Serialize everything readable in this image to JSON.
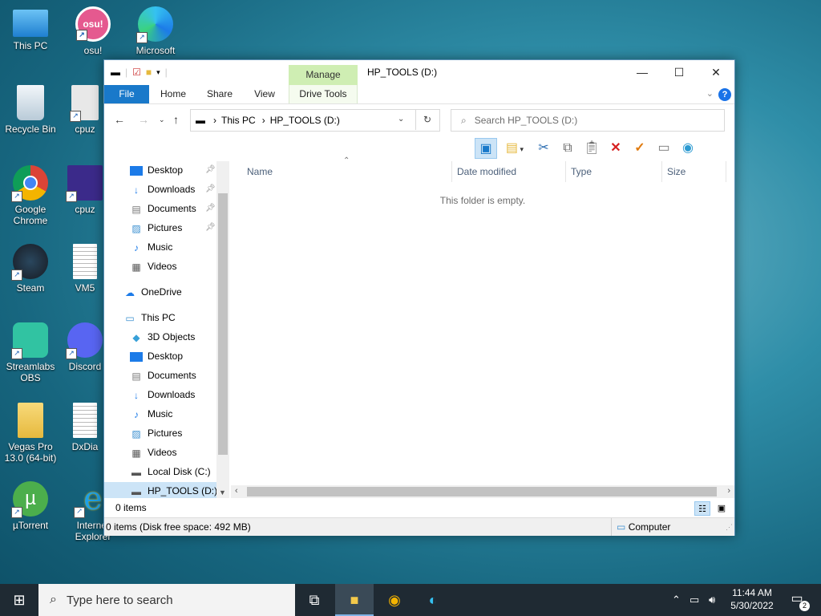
{
  "desktop": {
    "icons": [
      {
        "label": "This PC"
      },
      {
        "label": "osu!",
        "badge": "osu!"
      },
      {
        "label": "Microsoft"
      },
      {
        "label": "Recycle Bin"
      },
      {
        "label": "cpuz"
      },
      {
        "label": "Google Chrome"
      },
      {
        "label": "cpuz"
      },
      {
        "label": "Steam"
      },
      {
        "label": "VM5"
      },
      {
        "label": "Streamlabs OBS"
      },
      {
        "label": "Discord"
      },
      {
        "label": "Vegas Pro 13.0 (64-bit)"
      },
      {
        "label": "DxDia"
      },
      {
        "label": "µTorrent"
      },
      {
        "label": "Internet Explorer"
      }
    ]
  },
  "window": {
    "title": "HP_TOOLS (D:)",
    "manage_tab": "Manage",
    "tabs": {
      "file": "File",
      "home": "Home",
      "share": "Share",
      "view": "View",
      "drive_tools": "Drive Tools"
    },
    "controls": {
      "minimize": "—",
      "maximize": "☐",
      "close": "✕"
    },
    "help": "?"
  },
  "address": {
    "segments": [
      "This PC",
      "HP_TOOLS (D:)"
    ],
    "separator": "›",
    "search_placeholder": "Search HP_TOOLS (D:)"
  },
  "nav": {
    "quick_access": [
      {
        "label": "Desktop",
        "icon": "desktop-icon",
        "pinned": true
      },
      {
        "label": "Downloads",
        "icon": "downloads-icon",
        "pinned": true
      },
      {
        "label": "Documents",
        "icon": "documents-icon",
        "pinned": true
      },
      {
        "label": "Pictures",
        "icon": "pictures-icon",
        "pinned": true
      },
      {
        "label": "Music",
        "icon": "music-icon",
        "pinned": false
      },
      {
        "label": "Videos",
        "icon": "videos-icon",
        "pinned": false
      }
    ],
    "onedrive": "OneDrive",
    "this_pc": "This PC",
    "this_pc_items": [
      {
        "label": "3D Objects",
        "icon": "3d-objects-icon"
      },
      {
        "label": "Desktop",
        "icon": "desktop-icon"
      },
      {
        "label": "Documents",
        "icon": "documents-icon"
      },
      {
        "label": "Downloads",
        "icon": "downloads-icon"
      },
      {
        "label": "Music",
        "icon": "music-icon"
      },
      {
        "label": "Pictures",
        "icon": "pictures-icon"
      },
      {
        "label": "Videos",
        "icon": "videos-icon"
      },
      {
        "label": "Local Disk (C:)",
        "icon": "local-disk-icon"
      },
      {
        "label": "HP_TOOLS (D:)",
        "icon": "drive-icon",
        "selected": true
      }
    ]
  },
  "content": {
    "columns": [
      "Name",
      "Date modified",
      "Type",
      "Size"
    ],
    "empty_message": "This folder is empty."
  },
  "status": {
    "items": "0 items",
    "details": "0 items (Disk free space: 492 MB)",
    "zone": "Computer"
  },
  "taskbar": {
    "search_placeholder": "Type here to search",
    "time": "11:44 AM",
    "date": "5/30/2022",
    "notification_count": "2"
  },
  "colors": {
    "accent": "#1979ca",
    "manage_tab": "#cfeeb3",
    "selection": "#cce4f7",
    "taskbar": "#1f2a33"
  }
}
